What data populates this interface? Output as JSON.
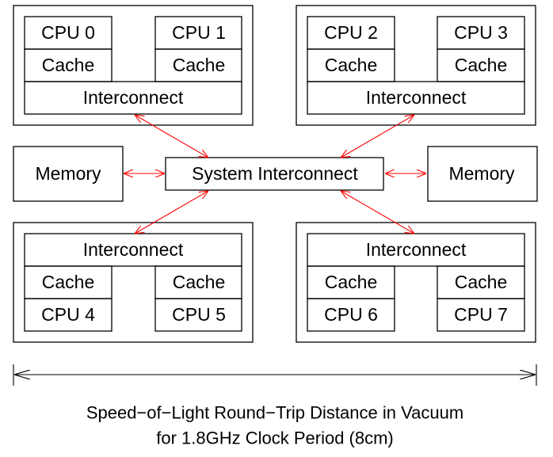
{
  "nodes": {
    "cpu": [
      "CPU 0",
      "CPU 1",
      "CPU 2",
      "CPU 3",
      "CPU 4",
      "CPU 5",
      "CPU 6",
      "CPU 7"
    ],
    "cache": "Cache",
    "interconnect": "Interconnect",
    "memory": "Memory",
    "system_interconnect": "System Interconnect"
  },
  "colors": {
    "link_arrows": "#ff0000",
    "outline": "#000000"
  },
  "caption": {
    "line1": "Speed−of−Light Round−Trip Distance in Vacuum",
    "line2": "for 1.8GHz Clock Period (8cm)"
  }
}
